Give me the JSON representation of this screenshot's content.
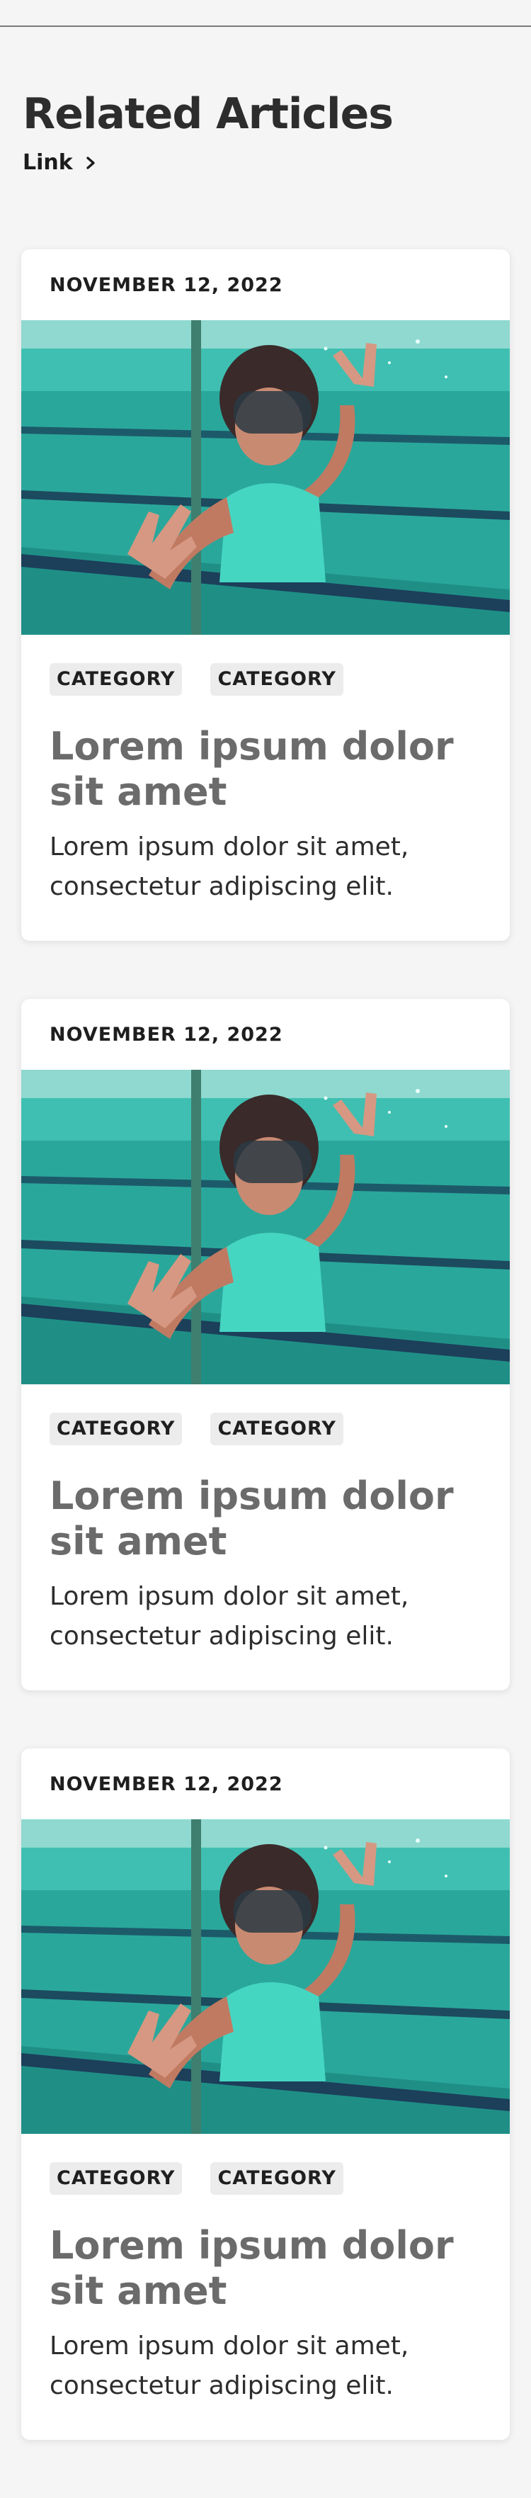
{
  "header": {
    "title": "Related Articles",
    "link_label": "Link"
  },
  "icons": {
    "link_chevron": "chevron-right-icon"
  },
  "articles": [
    {
      "date": "NOVEMBER 12, 2022",
      "tags": [
        "CATEGORY",
        "CATEGORY"
      ],
      "title": "Lorem ipsum dolor sit amet",
      "excerpt": "Lorem ipsum dolor sit amet, consectetur adipiscing elit."
    },
    {
      "date": "NOVEMBER 12, 2022",
      "tags": [
        "CATEGORY",
        "CATEGORY"
      ],
      "title": "Lorem ipsum dolor sit amet",
      "excerpt": "Lorem ipsum dolor sit amet, consectetur adipiscing elit."
    },
    {
      "date": "NOVEMBER 12, 2022",
      "tags": [
        "CATEGORY",
        "CATEGORY"
      ],
      "title": "Lorem ipsum dolor sit amet",
      "excerpt": "Lorem ipsum dolor sit amet, consectetur adipiscing elit."
    }
  ]
}
